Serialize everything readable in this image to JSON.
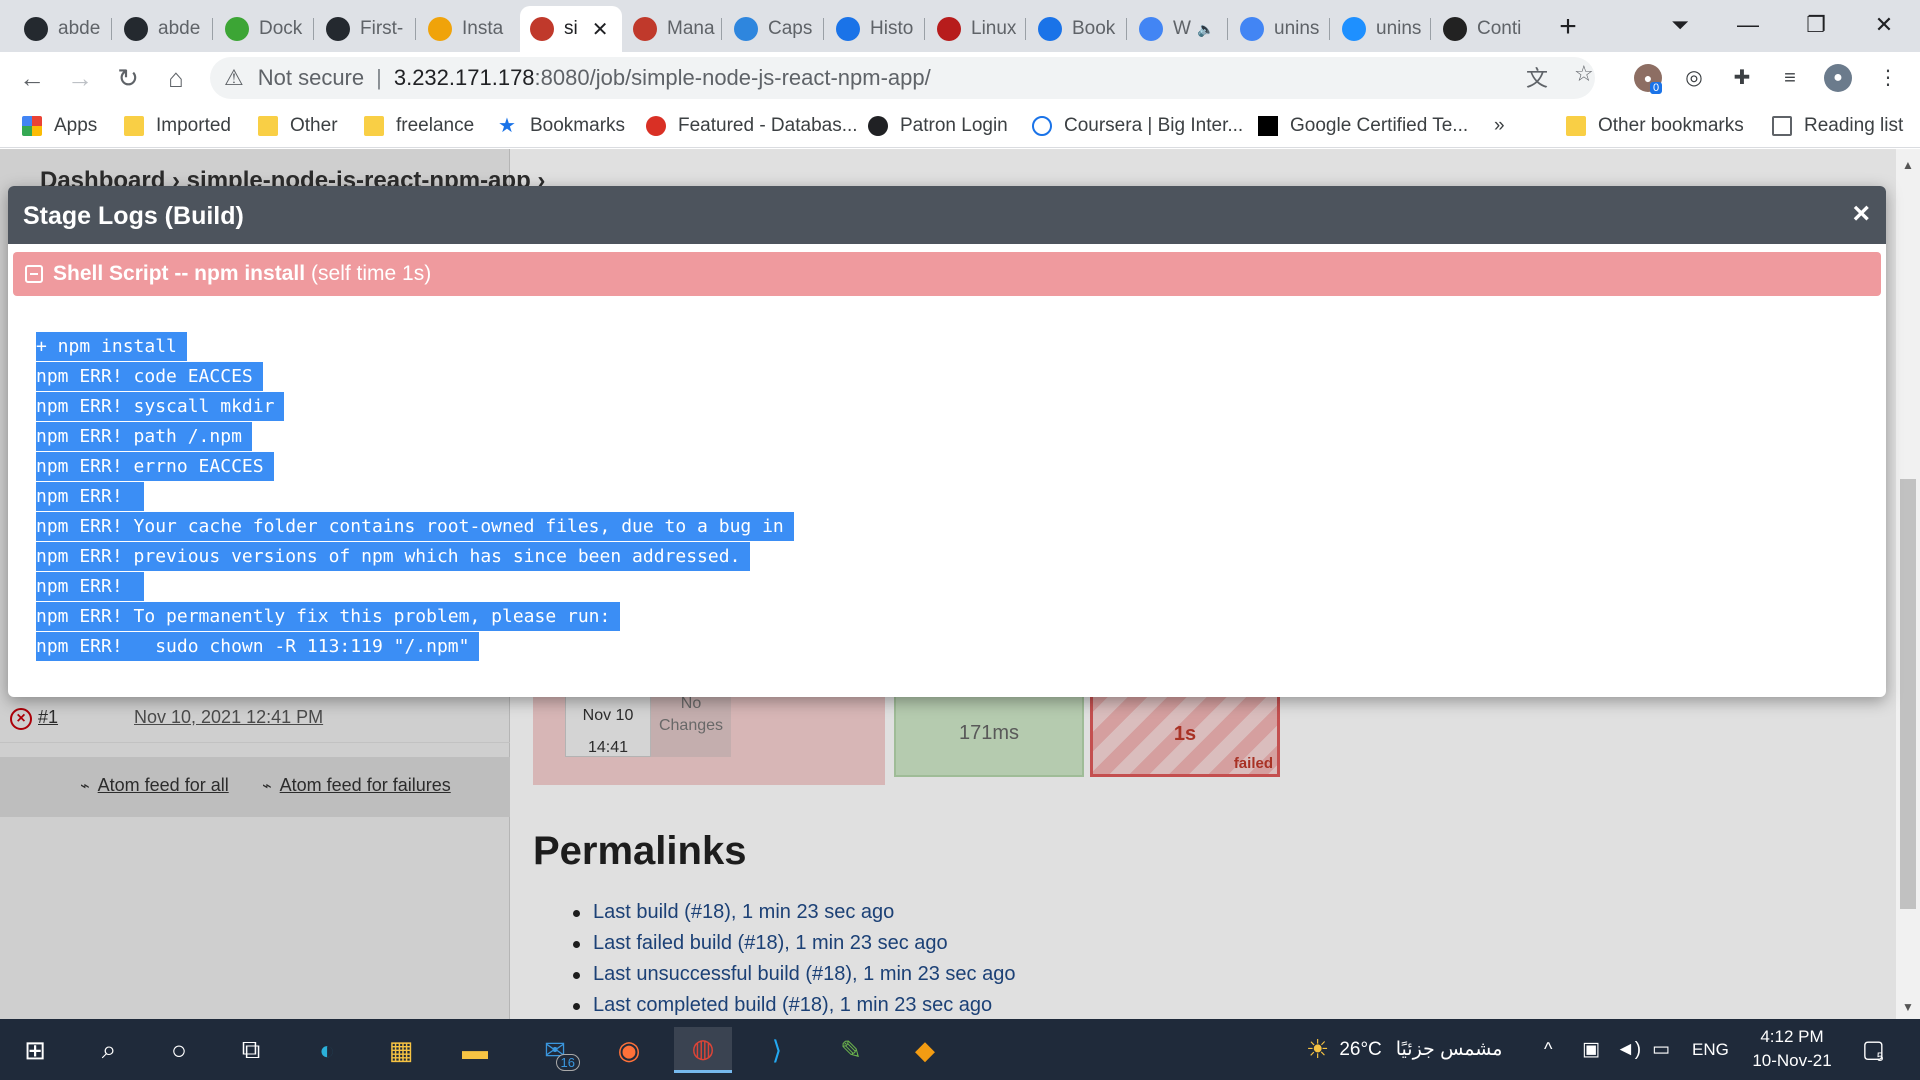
{
  "browser": {
    "tabs": [
      {
        "label": "abde",
        "icon": "github-icon",
        "color": "#24292f"
      },
      {
        "label": "abde",
        "icon": "github-icon",
        "color": "#24292f"
      },
      {
        "label": "Dock",
        "icon": "docker-icon",
        "color": "#3ca535"
      },
      {
        "label": "First-",
        "icon": "github-icon",
        "color": "#24292f"
      },
      {
        "label": "Insta",
        "icon": "box-icon",
        "color": "#f0a30a"
      },
      {
        "label": "si",
        "icon": "jenkins-icon",
        "color": "#c0392b",
        "active": true
      },
      {
        "label": "Mana",
        "icon": "jenkins-icon",
        "color": "#c0392b"
      },
      {
        "label": "Caps",
        "icon": "udacity-icon",
        "color": "#2e86de"
      },
      {
        "label": "Histo",
        "icon": "history-icon",
        "color": "#1a73e8"
      },
      {
        "label": "Linux",
        "icon": "linux-icon",
        "color": "#b71c1c"
      },
      {
        "label": "Book",
        "icon": "star-icon",
        "color": "#1a73e8"
      },
      {
        "label": "W",
        "icon": "google-icon",
        "color": "#4285f4",
        "muted": true
      },
      {
        "label": "unins",
        "icon": "google-icon",
        "color": "#4285f4"
      },
      {
        "label": "unins",
        "icon": "web-icon",
        "color": "#1e90ff"
      },
      {
        "label": "Conti",
        "icon": "contrast-icon",
        "color": "#222222"
      }
    ],
    "address": {
      "security": "Not secure",
      "host": "3.232.171.178",
      "path": ":8080/job/simple-node-js-react-npm-app/"
    },
    "profile_badge": "0",
    "bookmarks": [
      {
        "label": "Apps",
        "icon": "apps-icon"
      },
      {
        "label": "Imported",
        "icon": "folder-icon"
      },
      {
        "label": "Other",
        "icon": "folder-icon"
      },
      {
        "label": "freelance",
        "icon": "folder-icon"
      },
      {
        "label": "Bookmarks",
        "icon": "star-icon"
      },
      {
        "label": "Featured - Databas...",
        "icon": "database-icon"
      },
      {
        "label": "Patron Login",
        "icon": "patron-icon"
      },
      {
        "label": "Coursera | Big Inter...",
        "icon": "coursera-icon"
      },
      {
        "label": "Google Certified Te...",
        "icon": "medium-icon"
      }
    ],
    "bookmarks_overflow": "»",
    "other_bookmarks": "Other bookmarks",
    "reading_list": "Reading list"
  },
  "jenkins": {
    "breadcrumb": "Dashboard  ›  simple-node-js-react-npm-app  ›",
    "build": {
      "number": "#1",
      "date": "Nov 10, 2021 12:41 PM"
    },
    "feeds": {
      "all": "Atom feed for all",
      "failures": "Atom feed for failures"
    },
    "stage_view": {
      "date": "Nov 10",
      "time": "14:41",
      "changes": "No Changes",
      "stage1_time": "171ms",
      "stage2_time": "1s",
      "stage2_status": "failed"
    },
    "permalinks_title": "Permalinks",
    "permalinks": [
      "Last build (#18), 1 min 23 sec ago",
      "Last failed build (#18), 1 min 23 sec ago",
      "Last unsuccessful build (#18), 1 min 23 sec ago",
      "Last completed build (#18), 1 min 23 sec ago"
    ]
  },
  "modal": {
    "title": "Stage Logs (Build)",
    "close": "×",
    "step_name": "Shell Script -- npm install",
    "step_time": "(self time 1s)",
    "log_lines": [
      "+ npm install",
      "npm ERR! code EACCES",
      "npm ERR! syscall mkdir",
      "npm ERR! path /.npm",
      "npm ERR! errno EACCES",
      "npm ERR! ",
      "npm ERR! Your cache folder contains root-owned files, due to a bug in",
      "npm ERR! previous versions of npm which has since been addressed.",
      "npm ERR! ",
      "npm ERR! To permanently fix this problem, please run:",
      "npm ERR!   sudo chown -R 113:119 \"/.npm\""
    ]
  },
  "taskbar": {
    "mail_badge": "16",
    "weather": "26°C",
    "weather_text": "مشمس جزئيًا",
    "language": "ENG",
    "time": "4:12 PM",
    "date": "10-Nov-21",
    "notifications": "5"
  }
}
